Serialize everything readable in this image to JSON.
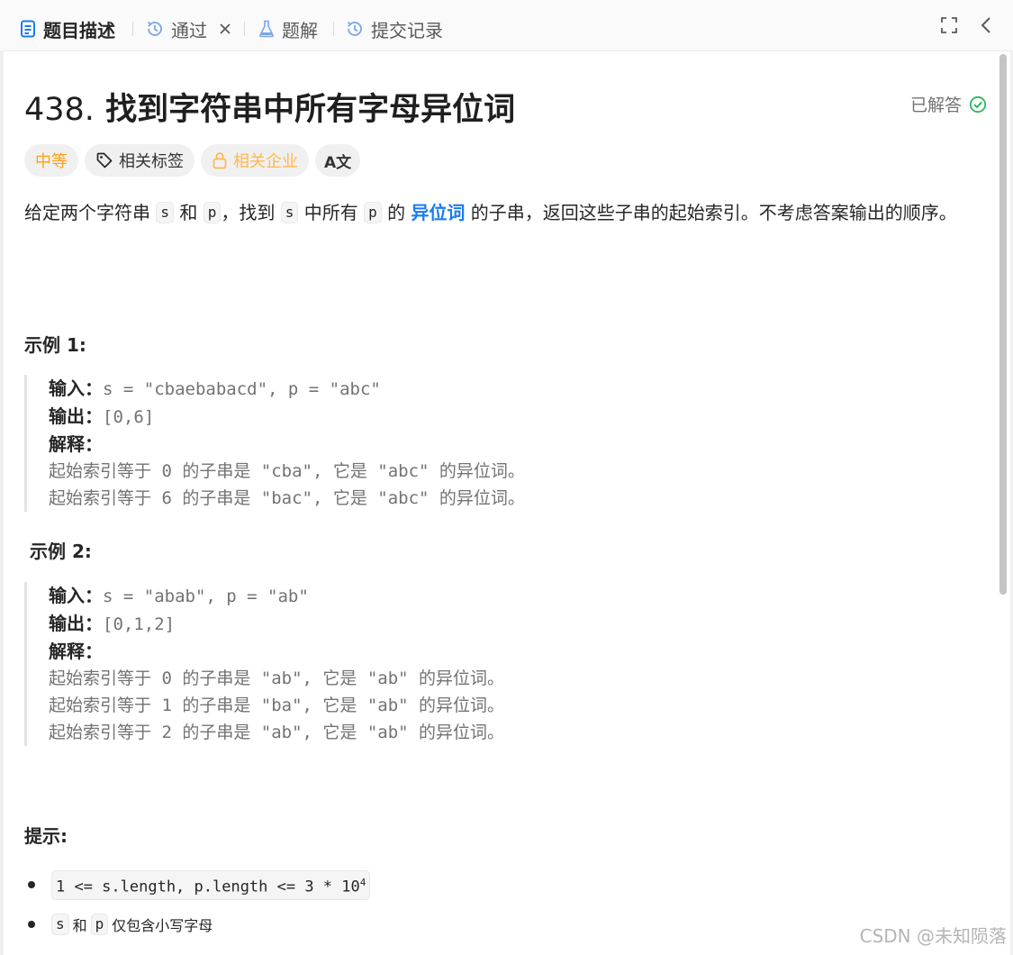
{
  "tabs": [
    {
      "label": "题目描述",
      "icon": "description-icon",
      "active": true
    },
    {
      "label": "通过",
      "icon": "history-icon",
      "closable": true
    },
    {
      "label": "题解",
      "icon": "flask-icon"
    },
    {
      "label": "提交记录",
      "icon": "history-icon"
    }
  ],
  "toolbar": {
    "fullscreen_icon": "fullscreen-icon",
    "collapse_icon": "chevron-left-icon"
  },
  "problem": {
    "number": "438.",
    "title": "找到字符串中所有字母异位词",
    "solved_label": "已解答",
    "difficulty": "中等",
    "tags": [
      "相关标签",
      "相关企业"
    ],
    "translate_label": "A文"
  },
  "description": {
    "t1": "给定两个字符串 ",
    "c1": "s",
    "t2": " 和 ",
    "c2": "p",
    "t3": "，找到 ",
    "c3": "s",
    "t4": " 中所有 ",
    "c4": "p",
    "t5": " 的 ",
    "link": "异位词",
    "t6": " 的子串，返回这些子串的起始索引。不考虑答案输出的顺序。"
  },
  "examples": [
    {
      "title": "示例 1:",
      "input_label": "输入：",
      "input": "s = \"cbaebabacd\", p = \"abc\"",
      "output_label": "输出：",
      "output": "[0,6]",
      "explain_label": "解释：",
      "explanations": [
        "起始索引等于 0 的子串是 \"cba\", 它是 \"abc\" 的异位词。",
        "起始索引等于 6 的子串是 \"bac\", 它是 \"abc\" 的异位词。"
      ]
    },
    {
      "title": "示例 2:",
      "input_label": "输入：",
      "input": "s = \"abab\", p = \"ab\"",
      "output_label": "输出：",
      "output": "[0,1,2]",
      "explain_label": "解释：",
      "explanations": [
        "起始索引等于 0 的子串是 \"ab\", 它是 \"ab\" 的异位词。",
        "起始索引等于 1 的子串是 \"ba\", 它是 \"ab\" 的异位词。",
        "起始索引等于 2 的子串是 \"ab\", 它是 \"ab\" 的异位词。"
      ]
    }
  ],
  "hints": {
    "title": "提示:",
    "h1_code": "1 <= s.length, p.length <= 3 * 10",
    "h1_exp": "4",
    "h2_c1": "s",
    "h2_t1": "和",
    "h2_c2": "p",
    "h2_t2": "仅包含小写字母"
  },
  "watermark": "CSDN @未知陨落",
  "colors": {
    "accent": "#1a7cf2",
    "medium": "#ffa116",
    "solved": "#2db55d"
  }
}
